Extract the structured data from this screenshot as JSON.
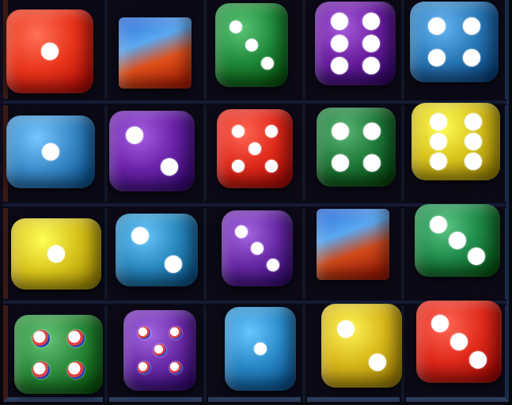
{
  "scene": {
    "description_name": "dice-grid",
    "rows": 4,
    "columns": 5
  },
  "dice": [
    {
      "name": "die-r1c1",
      "color": "#e8341a",
      "value": 1
    },
    {
      "name": "die-r1c2",
      "color": "#e0501a",
      "value": 0
    },
    {
      "name": "die-r1c3",
      "color": "#1f8a3a",
      "value": 3
    },
    {
      "name": "die-r1c4",
      "color": "#6a1ea0",
      "value": 6
    },
    {
      "name": "die-r1c5",
      "color": "#2a7ab8",
      "value": 4
    },
    {
      "name": "die-r2c1",
      "color": "#3a8ac8",
      "value": 1
    },
    {
      "name": "die-r2c2",
      "color": "#6a22a8",
      "value": 2
    },
    {
      "name": "die-r2c3",
      "color": "#e02a1a",
      "value": 5
    },
    {
      "name": "die-r2c4",
      "color": "#1f7a3a",
      "value": 4
    },
    {
      "name": "die-r2c5",
      "color": "#d8c21a",
      "value": 6
    },
    {
      "name": "die-r3c1",
      "color": "#d8c21a",
      "value": 1
    },
    {
      "name": "die-r3c2",
      "color": "#2a8ac0",
      "value": 2
    },
    {
      "name": "die-r3c3",
      "color": "#6a2aa8",
      "value": 3
    },
    {
      "name": "die-r3c4",
      "color": "#d04a1a",
      "value": 0
    },
    {
      "name": "die-r3c5",
      "color": "#1f8a4a",
      "value": 3
    },
    {
      "name": "die-r4c1",
      "color": "#2a8a3a",
      "value": 4
    },
    {
      "name": "die-r4c2",
      "color": "#6a2aa8",
      "value": 5
    },
    {
      "name": "die-r4c3",
      "color": "#2a8ac8",
      "value": 1
    },
    {
      "name": "die-r4c4",
      "color": "#d8b81a",
      "value": 2
    },
    {
      "name": "die-r4c5",
      "color": "#e02a1a",
      "value": 3
    }
  ]
}
